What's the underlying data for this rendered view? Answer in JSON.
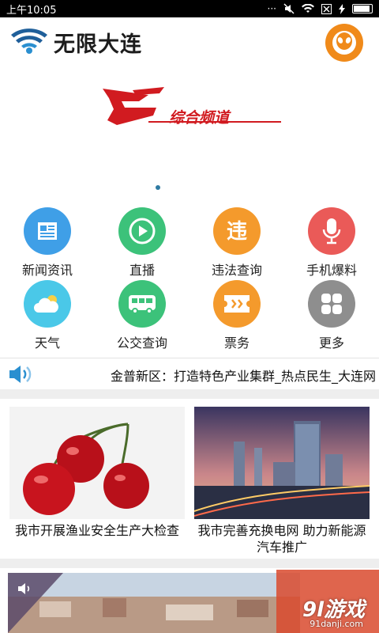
{
  "status_bar": {
    "time": "上午10:05",
    "dots": "···"
  },
  "header": {
    "title": "无限大连"
  },
  "banner": {
    "text": "综合频道"
  },
  "grid": [
    {
      "label": "新闻资讯",
      "icon": "newspaper-icon",
      "color": "#3f9fe7"
    },
    {
      "label": "直播",
      "icon": "play-icon",
      "color": "#3cc27a"
    },
    {
      "label": "违法查询",
      "icon": "violation-icon",
      "color": "#f49a2c"
    },
    {
      "label": "手机爆料",
      "icon": "microphone-icon",
      "color": "#ea5a58"
    },
    {
      "label": "天气",
      "icon": "weather-icon",
      "color": "#4ac8e8"
    },
    {
      "label": "公交查询",
      "icon": "bus-icon",
      "color": "#3cc27a"
    },
    {
      "label": "票务",
      "icon": "ticket-icon",
      "color": "#f49a2c"
    },
    {
      "label": "更多",
      "icon": "more-grid-icon",
      "color": "#8e8e8e"
    }
  ],
  "ticker": {
    "text": "金普新区：打造特色产业集群_热点民生_大连网"
  },
  "news": [
    {
      "title": "我市开展渔业安全生产大检查"
    },
    {
      "title": "我市完善充换电网 助力新能源汽车推广"
    }
  ],
  "watermark": {
    "main": "9l游戏",
    "sub": "91danji.com"
  }
}
